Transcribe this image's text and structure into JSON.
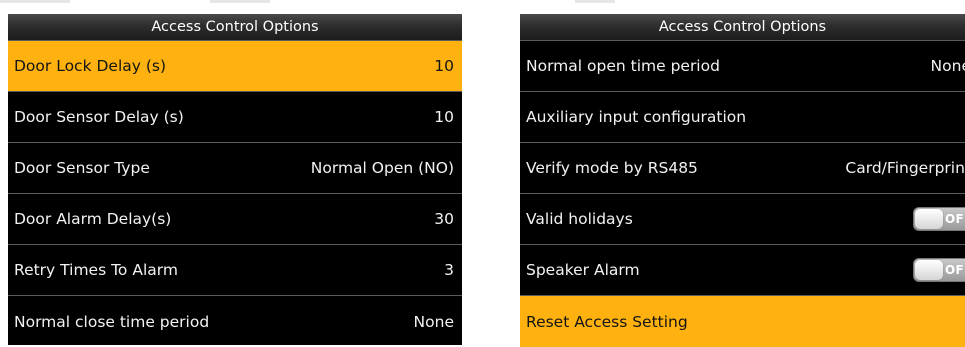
{
  "left_screen": {
    "title": "Access Control Options",
    "items": [
      {
        "label": "Door Lock Delay (s)",
        "value": "10",
        "selected": true
      },
      {
        "label": "Door Sensor Delay (s)",
        "value": "10",
        "selected": false
      },
      {
        "label": "Door Sensor Type",
        "value": "Normal Open (NO)",
        "selected": false
      },
      {
        "label": "Door Alarm Delay(s)",
        "value": "30",
        "selected": false
      },
      {
        "label": "Retry Times To Alarm",
        "value": "3",
        "selected": false
      },
      {
        "label": "Normal close time period",
        "value": "None",
        "selected": false
      }
    ]
  },
  "right_screen": {
    "title": "Access Control Options",
    "items": [
      {
        "label": "Normal open time period",
        "value": "None",
        "selected": false
      },
      {
        "label": "Auxiliary input configuration",
        "value": "",
        "selected": false
      },
      {
        "label": "Verify mode by RS485",
        "value": "Card/Fingerprint",
        "selected": false
      },
      {
        "label": "Valid holidays",
        "toggle": "OFF",
        "selected": false
      },
      {
        "label": "Speaker Alarm",
        "toggle": "OFF",
        "selected": false
      },
      {
        "label": "Reset Access Setting",
        "value": "",
        "selected": true
      }
    ]
  },
  "colors": {
    "selected_highlight": "#ffb20f",
    "background": "#000000",
    "text": "#f2f2f2"
  }
}
